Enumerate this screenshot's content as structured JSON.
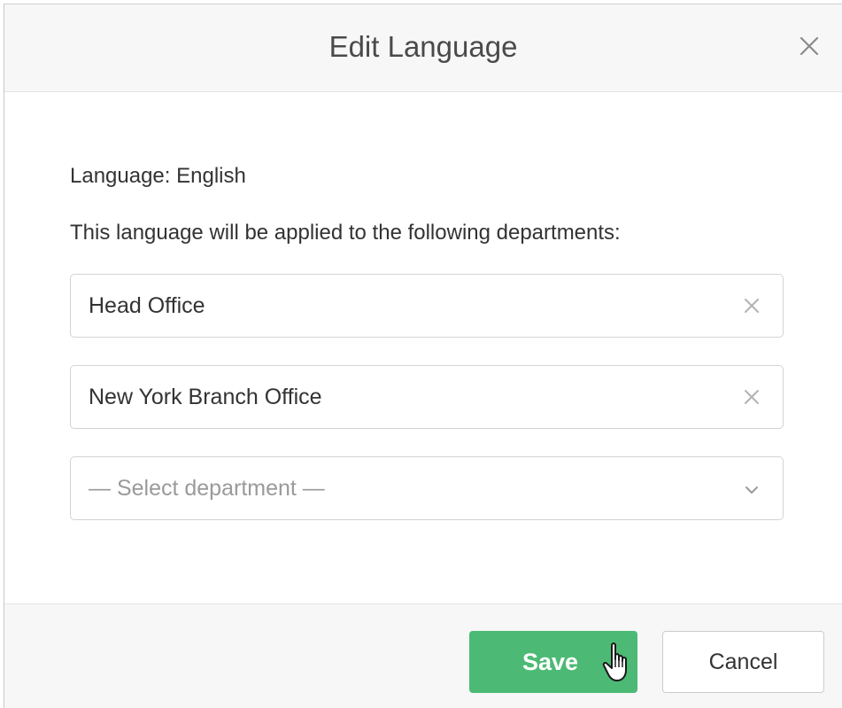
{
  "dialog": {
    "title": "Edit Language"
  },
  "body": {
    "language_line": "Language: English",
    "description": "This language will be applied to the following departments:",
    "departments": [
      {
        "label": "Head Office"
      },
      {
        "label": "New York Branch Office"
      }
    ],
    "select": {
      "placeholder": "— Select department —"
    }
  },
  "footer": {
    "save_label": "Save",
    "cancel_label": "Cancel"
  },
  "colors": {
    "save_button": "#4cba74",
    "header_bg": "#f7f7f7",
    "border": "#d4d4d4"
  },
  "icons": {
    "close": "close-icon",
    "remove": "remove-icon",
    "dropdown": "chevron-down-icon",
    "cursor": "hand-pointer-icon"
  }
}
